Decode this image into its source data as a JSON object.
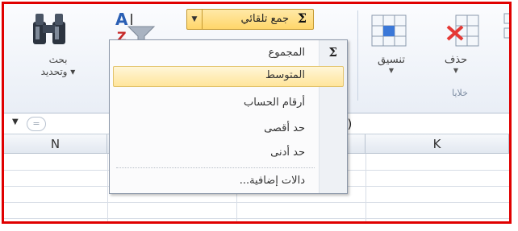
{
  "ribbon": {
    "autosum_label": "جمع تلقائي",
    "autosum_symbol": "Σ",
    "find_select_line1": "بحث",
    "find_select_line2": "وتحديد",
    "format_label": "تنسيق",
    "delete_label": "حذف",
    "cells_group_label": "خلايا"
  },
  "formula_bar": {
    "fx": "=",
    "content": "3)"
  },
  "grid": {
    "columns": [
      "N",
      "K"
    ]
  },
  "autosum_menu": {
    "items": [
      {
        "label": "المجموع",
        "icon": "Σ"
      },
      {
        "label": "المتوسط"
      },
      {
        "label": "أرقام الحساب"
      },
      {
        "label": "حد أقصى"
      },
      {
        "label": "حد أدنى"
      },
      {
        "label": "دالات إضافية..."
      }
    ],
    "highlighted_index": 1
  },
  "colors": {
    "frame_border": "#e00000",
    "highlight_fill": "#ffe59b",
    "autosum_fill": "#ffd66a",
    "ribbon_bg": "#e9eef6"
  }
}
